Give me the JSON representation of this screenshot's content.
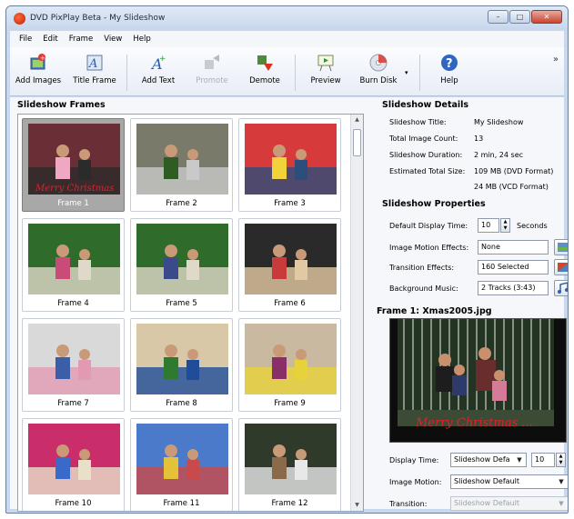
{
  "window": {
    "title": "DVD PixPlay Beta - My Slideshow"
  },
  "menu": [
    "File",
    "Edit",
    "Frame",
    "View",
    "Help"
  ],
  "toolbar": {
    "add_images": "Add Images",
    "title_frame": "Title Frame",
    "add_text": "Add Text",
    "promote": "Promote",
    "demote": "Demote",
    "preview": "Preview",
    "burn_disk": "Burn Disk",
    "help": "Help"
  },
  "frames_panel": {
    "title": "Slideshow Frames",
    "frames": [
      "Frame 1",
      "Frame 2",
      "Frame 3",
      "Frame 4",
      "Frame 5",
      "Frame 6",
      "Frame 7",
      "Frame 8",
      "Frame 9",
      "Frame 10",
      "Frame 11",
      "Frame 12"
    ],
    "thumb_caption": "Merry Christmas"
  },
  "details": {
    "title": "Slideshow Details",
    "rows": [
      {
        "label": "Slideshow Title:",
        "value": "My Slideshow"
      },
      {
        "label": "Total Image Count:",
        "value": "13"
      },
      {
        "label": "Slideshow Duration:",
        "value": "2 min, 24 sec"
      },
      {
        "label": "Estimated Total Size:",
        "value": "109 MB (DVD Format)"
      }
    ],
    "size_line2": "24 MB (VCD Format)"
  },
  "properties": {
    "title": "Slideshow Properties",
    "display_time_label": "Default Display Time:",
    "display_time_value": "10",
    "seconds_label": "Seconds",
    "motion_label": "Image Motion Effects:",
    "motion_value": "None",
    "transition_label": "Transition Effects:",
    "transition_value": "160 Selected",
    "music_label": "Background Music:",
    "music_value": "2 Tracks (3:43)"
  },
  "frame_detail": {
    "title": "Frame 1: Xmas2005.jpg",
    "caption": "Merry Christmas ...",
    "display_time_label": "Display Time:",
    "display_time_select": "Slideshow Defa",
    "display_time_value": "10",
    "image_motion_label": "Image Motion:",
    "image_motion_value": "Slideshow Default",
    "transition_label": "Transition:",
    "transition_value": "Slideshow Default"
  },
  "colors": {
    "caption": "#e0202a",
    "selected_frame": "#a8a8a8",
    "accent": "#3a64b0"
  }
}
